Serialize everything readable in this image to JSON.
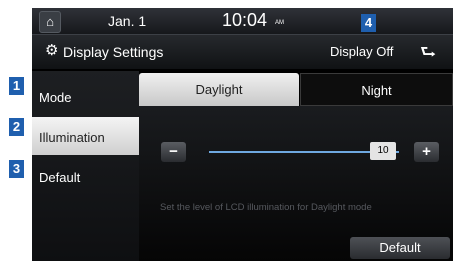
{
  "status": {
    "date": "Jan.  1",
    "time": "10:04",
    "ampm": "AM"
  },
  "header": {
    "title": "Display Settings",
    "display_off": "Display Off"
  },
  "callouts": {
    "mode": "1",
    "illumination": "2",
    "default": "3",
    "display_off": "4"
  },
  "sidebar": {
    "items": [
      {
        "label": "Mode"
      },
      {
        "label": "Illumination",
        "selected": true
      },
      {
        "label": "Default"
      }
    ]
  },
  "tabs": [
    {
      "label": "Daylight",
      "active": true
    },
    {
      "label": "Night"
    }
  ],
  "slider": {
    "value": "10",
    "level": 1.0,
    "minus": "−",
    "plus": "+"
  },
  "hint": "Set the level of LCD illumination for Daylight mode",
  "default_button": "Default",
  "colors": {
    "accent": "#1f5fae",
    "slider": "#6fa8e0"
  },
  "icons": {
    "home": "home-icon",
    "settings": "gear-icon",
    "back": "back-arrow-icon"
  }
}
